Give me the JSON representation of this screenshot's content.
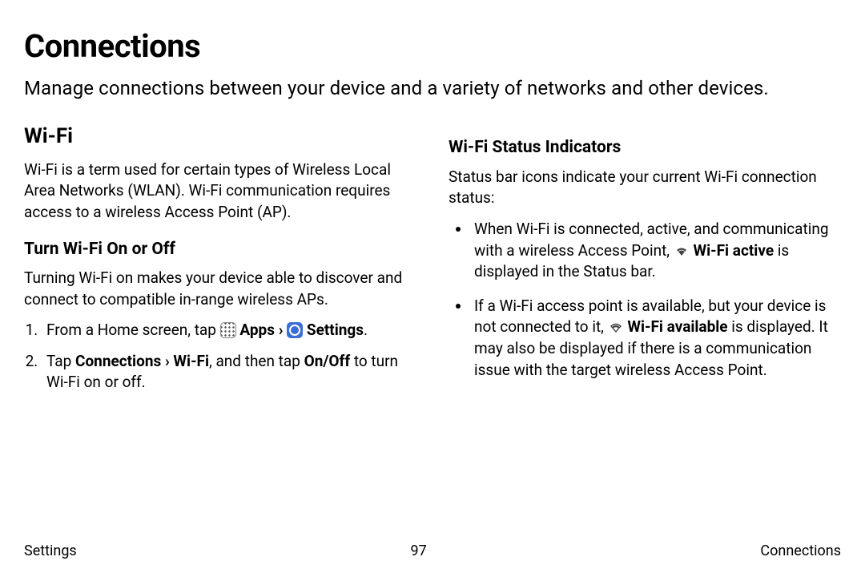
{
  "title": "Connections",
  "intro": "Manage connections between your device and a variety of networks and other devices.",
  "left": {
    "h2": "Wi-Fi",
    "p1": "Wi-Fi is a term used for certain types of Wireless Local Area Networks (WLAN). Wi-Fi communication requires access to a wireless Access Point (AP).",
    "h3": "Turn Wi-Fi On or Off",
    "p2": "Turning Wi-Fi on makes your device able to discover and connect to compatible in-range wireless APs.",
    "step1_pre": "From a Home screen, tap ",
    "step1_apps": "Apps",
    "step1_sep": " › ",
    "step1_settings": "Settings",
    "step1_end": ".",
    "step2_pre": "Tap ",
    "step2_bold": "Connections › Wi-Fi",
    "step2_mid": ", and then tap ",
    "step2_bold2": "On/Off",
    "step2_end": " to turn Wi-Fi on or off."
  },
  "right": {
    "h3": "Wi-Fi Status Indicators",
    "p1": "Status bar icons indicate your current Wi-Fi connection status:",
    "b1_pre": "When Wi-Fi is connected, active, and communicating with a wireless Access Point, ",
    "b1_bold": "Wi-Fi active",
    "b1_end": " is displayed in the Status bar.",
    "b2_pre": "If a Wi-Fi access point is available, but your device is not connected to it, ",
    "b2_bold": "Wi-Fi available",
    "b2_end": " is displayed. It may also be displayed if there is a communication issue with the target wireless Access Point."
  },
  "footer": {
    "left": "Settings",
    "center": "97",
    "right": "Connections"
  }
}
